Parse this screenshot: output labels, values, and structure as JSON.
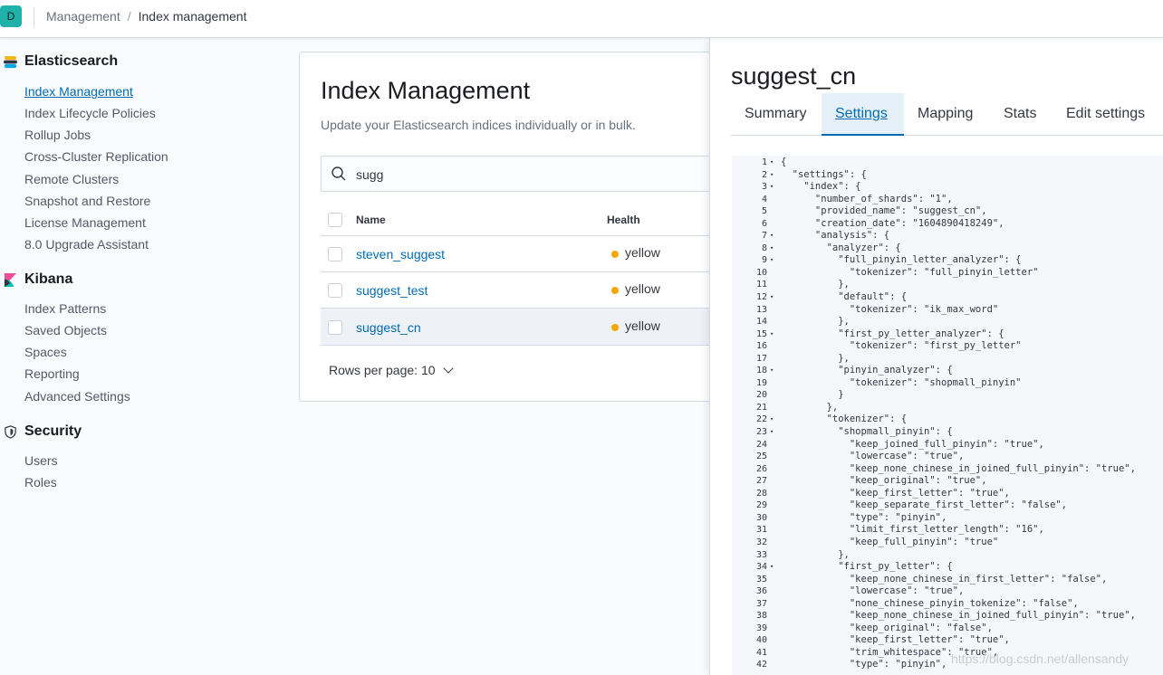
{
  "header": {
    "avatar_letter": "D",
    "breadcrumb": [
      "Management",
      "Index management"
    ]
  },
  "sidebar": {
    "sections": [
      {
        "title": "Elasticsearch",
        "icon": "elasticsearch-logo-icon",
        "items": [
          "Index Management",
          "Index Lifecycle Policies",
          "Rollup Jobs",
          "Cross-Cluster Replication",
          "Remote Clusters",
          "Snapshot and Restore",
          "License Management",
          "8.0 Upgrade Assistant"
        ]
      },
      {
        "title": "Kibana",
        "icon": "kibana-logo-icon",
        "items": [
          "Index Patterns",
          "Saved Objects",
          "Spaces",
          "Reporting",
          "Advanced Settings"
        ]
      },
      {
        "title": "Security",
        "icon": "shield-icon",
        "items": [
          "Users",
          "Roles"
        ]
      }
    ],
    "active_item": "Index Management"
  },
  "main": {
    "title": "Index Management",
    "subtitle": "Update your Elasticsearch indices individually or in bulk.",
    "search_value": "sugg",
    "table": {
      "columns": [
        "Name",
        "Health"
      ],
      "rows": [
        {
          "name": "steven_suggest",
          "health": "yellow"
        },
        {
          "name": "suggest_test",
          "health": "yellow"
        },
        {
          "name": "suggest_cn",
          "health": "yellow"
        }
      ]
    },
    "rows_per_page": "Rows per page: 10"
  },
  "flyout": {
    "title": "suggest_cn",
    "tabs": [
      "Summary",
      "Settings",
      "Mapping",
      "Stats",
      "Edit settings"
    ],
    "active_tab": "Settings",
    "code_lines": [
      {
        "n": "1",
        "f": true,
        "t": "{"
      },
      {
        "n": "2",
        "f": true,
        "t": "  \"settings\": {"
      },
      {
        "n": "3",
        "f": true,
        "t": "    \"index\": {"
      },
      {
        "n": "4",
        "f": false,
        "t": "      \"number_of_shards\": \"1\","
      },
      {
        "n": "5",
        "f": false,
        "t": "      \"provided_name\": \"suggest_cn\","
      },
      {
        "n": "6",
        "f": false,
        "t": "      \"creation_date\": \"1604890418249\","
      },
      {
        "n": "7",
        "f": true,
        "t": "      \"analysis\": {"
      },
      {
        "n": "8",
        "f": true,
        "t": "        \"analyzer\": {"
      },
      {
        "n": "9",
        "f": true,
        "t": "          \"full_pinyin_letter_analyzer\": {"
      },
      {
        "n": "10",
        "f": false,
        "t": "            \"tokenizer\": \"full_pinyin_letter\""
      },
      {
        "n": "11",
        "f": false,
        "t": "          },"
      },
      {
        "n": "12",
        "f": true,
        "t": "          \"default\": {"
      },
      {
        "n": "13",
        "f": false,
        "t": "            \"tokenizer\": \"ik_max_word\""
      },
      {
        "n": "14",
        "f": false,
        "t": "          },"
      },
      {
        "n": "15",
        "f": true,
        "t": "          \"first_py_letter_analyzer\": {"
      },
      {
        "n": "16",
        "f": false,
        "t": "            \"tokenizer\": \"first_py_letter\""
      },
      {
        "n": "17",
        "f": false,
        "t": "          },"
      },
      {
        "n": "18",
        "f": true,
        "t": "          \"pinyin_analyzer\": {"
      },
      {
        "n": "19",
        "f": false,
        "t": "            \"tokenizer\": \"shopmall_pinyin\""
      },
      {
        "n": "20",
        "f": false,
        "t": "          }"
      },
      {
        "n": "21",
        "f": false,
        "t": "        },"
      },
      {
        "n": "22",
        "f": true,
        "t": "        \"tokenizer\": {"
      },
      {
        "n": "23",
        "f": true,
        "t": "          \"shopmall_pinyin\": {"
      },
      {
        "n": "24",
        "f": false,
        "t": "            \"keep_joined_full_pinyin\": \"true\","
      },
      {
        "n": "25",
        "f": false,
        "t": "            \"lowercase\": \"true\","
      },
      {
        "n": "26",
        "f": false,
        "t": "            \"keep_none_chinese_in_joined_full_pinyin\": \"true\","
      },
      {
        "n": "27",
        "f": false,
        "t": "            \"keep_original\": \"true\","
      },
      {
        "n": "28",
        "f": false,
        "t": "            \"keep_first_letter\": \"true\","
      },
      {
        "n": "29",
        "f": false,
        "t": "            \"keep_separate_first_letter\": \"false\","
      },
      {
        "n": "30",
        "f": false,
        "t": "            \"type\": \"pinyin\","
      },
      {
        "n": "31",
        "f": false,
        "t": "            \"limit_first_letter_length\": \"16\","
      },
      {
        "n": "32",
        "f": false,
        "t": "            \"keep_full_pinyin\": \"true\""
      },
      {
        "n": "33",
        "f": false,
        "t": "          },"
      },
      {
        "n": "34",
        "f": true,
        "t": "          \"first_py_letter\": {"
      },
      {
        "n": "35",
        "f": false,
        "t": "            \"keep_none_chinese_in_first_letter\": \"false\","
      },
      {
        "n": "36",
        "f": false,
        "t": "            \"lowercase\": \"true\","
      },
      {
        "n": "37",
        "f": false,
        "t": "            \"none_chinese_pinyin_tokenize\": \"false\","
      },
      {
        "n": "38",
        "f": false,
        "t": "            \"keep_none_chinese_in_joined_full_pinyin\": \"true\","
      },
      {
        "n": "39",
        "f": false,
        "t": "            \"keep_original\": \"false\","
      },
      {
        "n": "40",
        "f": false,
        "t": "            \"keep_first_letter\": \"true\","
      },
      {
        "n": "41",
        "f": false,
        "t": "            \"trim_whitespace\": \"true\","
      },
      {
        "n": "42",
        "f": false,
        "t": "            \"type\": \"pinyin\","
      }
    ]
  },
  "watermark": "https://blog.csdn.net/allensandy",
  "colors": {
    "link": "#006bb4",
    "health_yellow": "#f5a700",
    "avatar": "#20b2aa"
  }
}
